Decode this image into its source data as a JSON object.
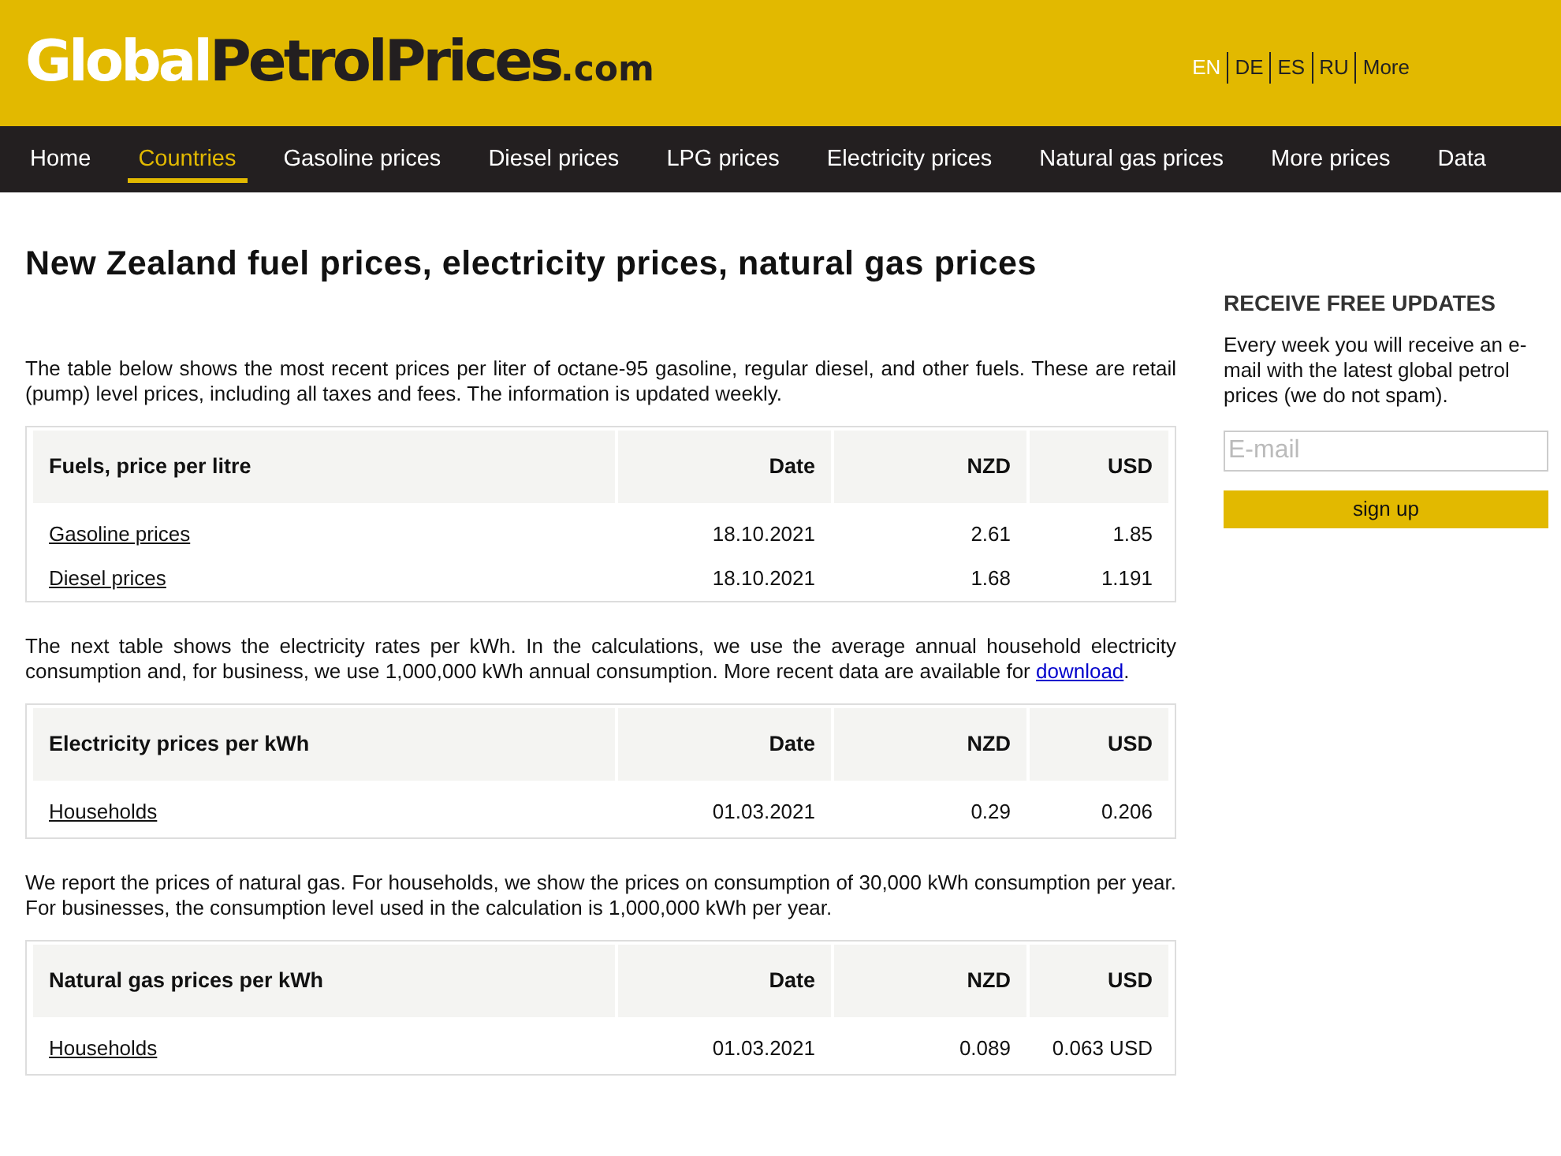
{
  "logo": {
    "part_1": "Global",
    "part_2": "PetrolPrices",
    "part_3": ".com"
  },
  "languages": [
    {
      "label": "EN",
      "selected": true
    },
    {
      "label": "DE",
      "selected": false
    },
    {
      "label": "ES",
      "selected": false
    },
    {
      "label": "RU",
      "selected": false
    },
    {
      "label": "More",
      "selected": false
    }
  ],
  "nav": [
    {
      "label": "Home",
      "selected": false
    },
    {
      "label": "Countries",
      "selected": true
    },
    {
      "label": "Gasoline prices",
      "selected": false
    },
    {
      "label": "Diesel prices",
      "selected": false
    },
    {
      "label": "LPG prices",
      "selected": false
    },
    {
      "label": "Electricity prices",
      "selected": false
    },
    {
      "label": "Natural gas prices",
      "selected": false
    },
    {
      "label": "More prices",
      "selected": false
    },
    {
      "label": "Data",
      "selected": false
    }
  ],
  "title": "New Zealand fuel prices, electricity prices, natural gas prices",
  "sections": [
    {
      "intro": {
        "text": "The table below shows the most recent prices per liter of octane-95 gasoline, regular diesel, and other fuels. These are retail (pump) level prices, including all taxes and fees. The information is updated weekly."
      },
      "table": {
        "columns": [
          "Fuels, price per litre",
          "Date",
          "NZD",
          "USD"
        ],
        "rows": [
          [
            "Gasoline prices",
            "18.10.2021",
            "2.61",
            "1.85"
          ],
          [
            "Diesel prices",
            "18.10.2021",
            "1.68",
            "1.191"
          ]
        ]
      }
    },
    {
      "intro": {
        "text": "The next table shows the electricity rates per kWh. In the calculations, we use the average annual household electricity consumption and, for business, we use 1,000,000 kWh annual consumption. More recent data are available for ",
        "link": "download",
        "text_after": "."
      },
      "table": {
        "columns": [
          "Electricity prices per kWh",
          "Date",
          "NZD",
          "USD"
        ],
        "rows": [
          [
            "Households",
            "01.03.2021",
            "0.29",
            "0.206"
          ]
        ]
      }
    },
    {
      "intro": {
        "text": "We report the prices of natural gas. For households, we show the prices on consumption of 30,000 kWh consumption per year. For businesses, the consumption level used in the calculation is 1,000,000 kWh per year."
      },
      "table": {
        "columns": [
          "Natural gas prices per kWh",
          "Date",
          "NZD",
          "USD"
        ],
        "rows": [
          [
            "Households",
            "01.03.2021",
            "0.089",
            "0.063 USD"
          ]
        ]
      }
    }
  ],
  "sidebar": {
    "heading": "RECEIVE FREE UPDATES",
    "text": "Every week you will receive an e-mail with the latest global petrol prices (we do not spam).",
    "email": {
      "placeholder": "E-mail"
    },
    "button": "sign up"
  }
}
